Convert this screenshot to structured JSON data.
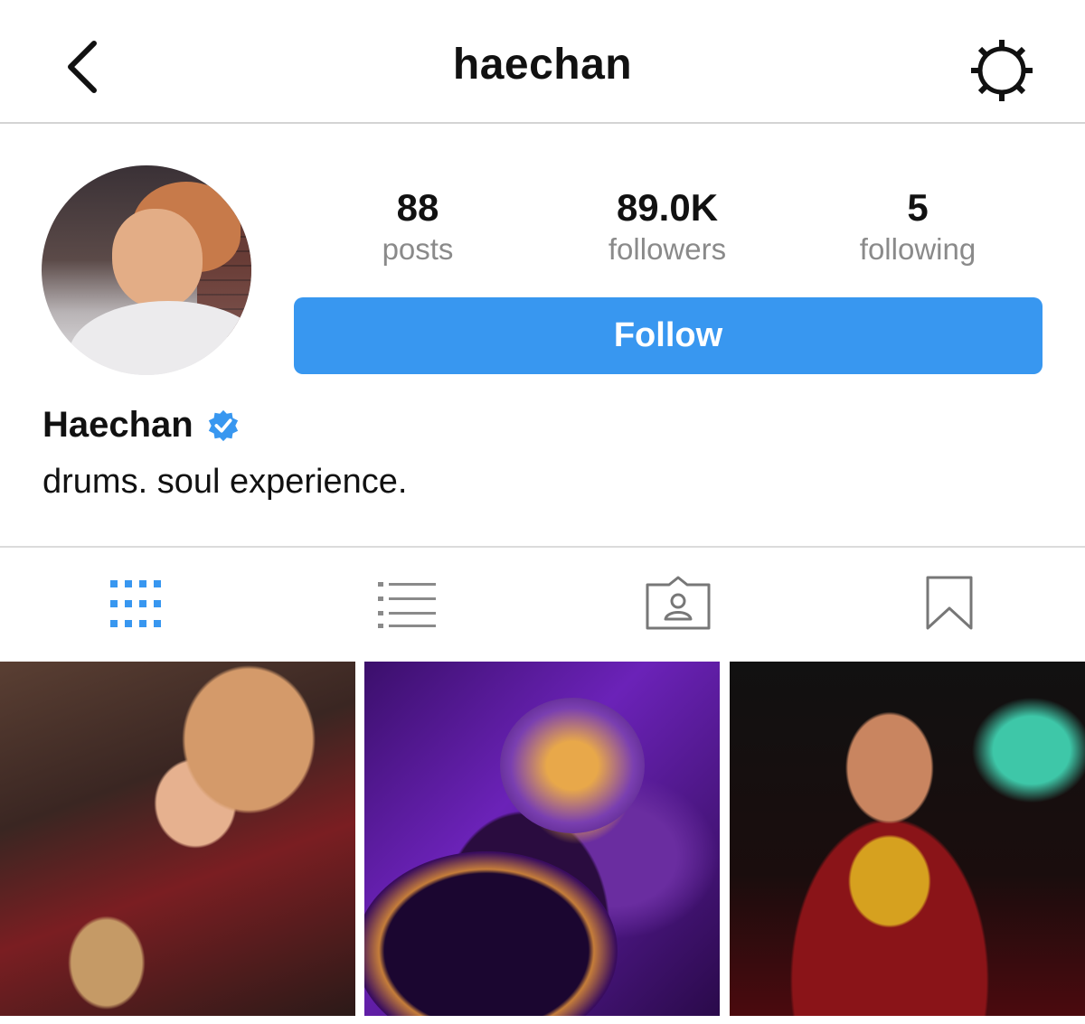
{
  "header": {
    "title": "haechan",
    "back_icon": "chevron-left-icon",
    "settings_icon": "gear-icon"
  },
  "profile": {
    "avatar_alt": "profile photo",
    "stats": [
      {
        "value": "88",
        "label": "posts"
      },
      {
        "value": "89.0K",
        "label": "followers"
      },
      {
        "value": "5",
        "label": "following"
      }
    ],
    "follow_label": "Follow",
    "display_name": "Haechan",
    "verified": true,
    "bio": "drums. soul experience."
  },
  "tabs": [
    {
      "icon": "grid-icon",
      "active": true
    },
    {
      "icon": "list-icon",
      "active": false
    },
    {
      "icon": "tagged-icon",
      "active": false
    },
    {
      "icon": "bookmark-icon",
      "active": false
    }
  ],
  "posts": [
    {
      "description": "photo"
    },
    {
      "description": "photo"
    },
    {
      "description": "photo"
    }
  ],
  "colors": {
    "accent": "#3897f0",
    "muted_text": "#8a8a8a",
    "border": "#dbdbdb"
  }
}
